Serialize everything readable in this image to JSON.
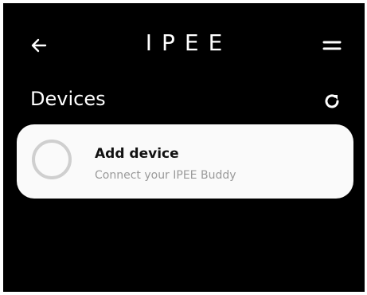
{
  "header": {
    "brand": "IPEE",
    "back_icon": "arrow-left-icon",
    "menu_icon": "equals-menu-icon"
  },
  "devices": {
    "title": "Devices",
    "refresh_icon": "refresh-icon"
  },
  "add_device_card": {
    "title": "Add device",
    "subtitle": "Connect your IPEE Buddy",
    "icon": "device-ring-icon"
  },
  "colors": {
    "background": "#000000",
    "card": "#fafafa",
    "text_primary": "#ffffff",
    "card_title": "#111111",
    "card_subtitle": "#9a9a9a",
    "ring": "#cfcfcf"
  }
}
